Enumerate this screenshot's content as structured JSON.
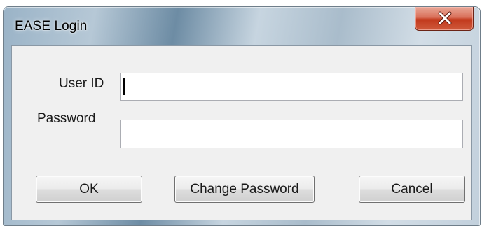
{
  "window": {
    "title": "EASE Login",
    "close_icon": "close-icon"
  },
  "form": {
    "user_id_label": "User ID",
    "user_id_value": "",
    "password_label": "Password",
    "password_value": ""
  },
  "buttons": {
    "ok_label": "OK",
    "change_password_accel": "C",
    "change_password_rest": "hange Password",
    "cancel_label": "Cancel"
  },
  "colors": {
    "close_button": "#c2391c",
    "dialog_face": "#f0f0f0"
  }
}
